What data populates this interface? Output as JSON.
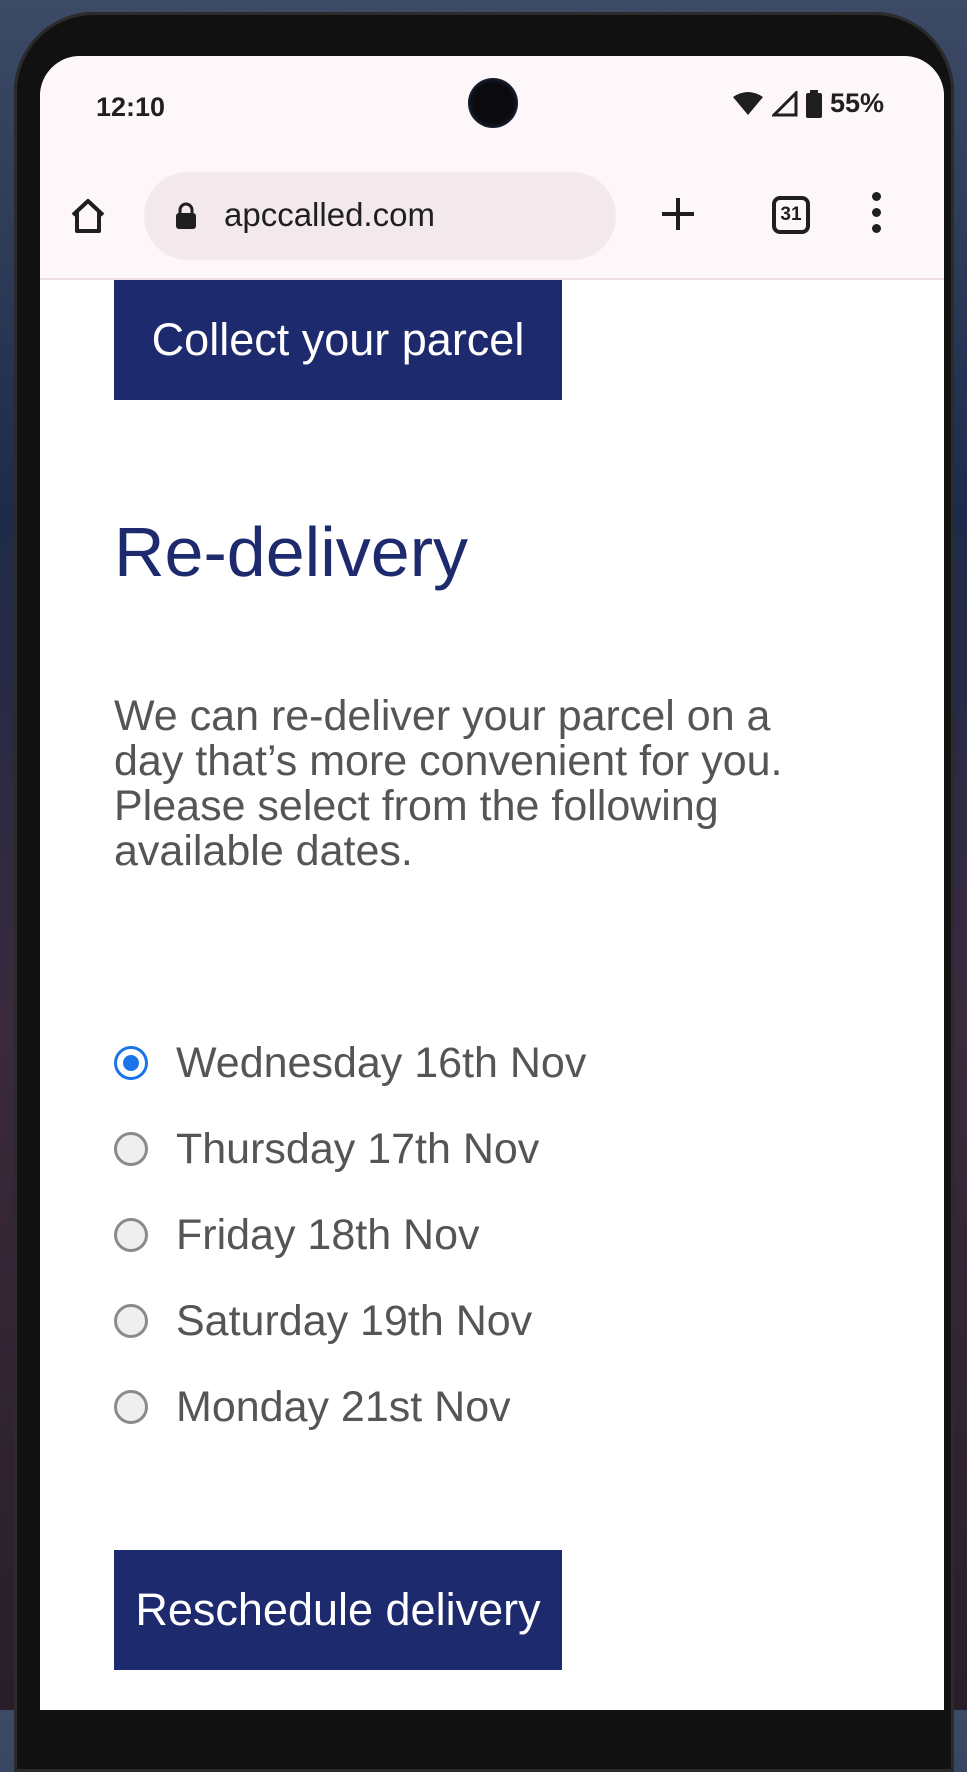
{
  "status_bar": {
    "time": "12:10",
    "battery": "55%"
  },
  "browser": {
    "url": "apccalled.com",
    "tab_count": "31"
  },
  "page": {
    "collect_button": "Collect your parcel",
    "heading": "Re-delivery",
    "intro": "We can re-deliver your parcel on a day that’s more convenient for you. Please select from the following available dates.",
    "dates": [
      {
        "label": "Wednesday 16th Nov",
        "selected": true
      },
      {
        "label": "Thursday 17th Nov",
        "selected": false
      },
      {
        "label": "Friday 18th Nov",
        "selected": false
      },
      {
        "label": "Saturday 19th Nov",
        "selected": false
      },
      {
        "label": "Monday 21st Nov",
        "selected": false
      }
    ],
    "reschedule_button": "Reschedule delivery"
  },
  "colors": {
    "brand": "#1e2a6e",
    "radio_selected": "#1a73e8",
    "body_text": "#555555"
  }
}
